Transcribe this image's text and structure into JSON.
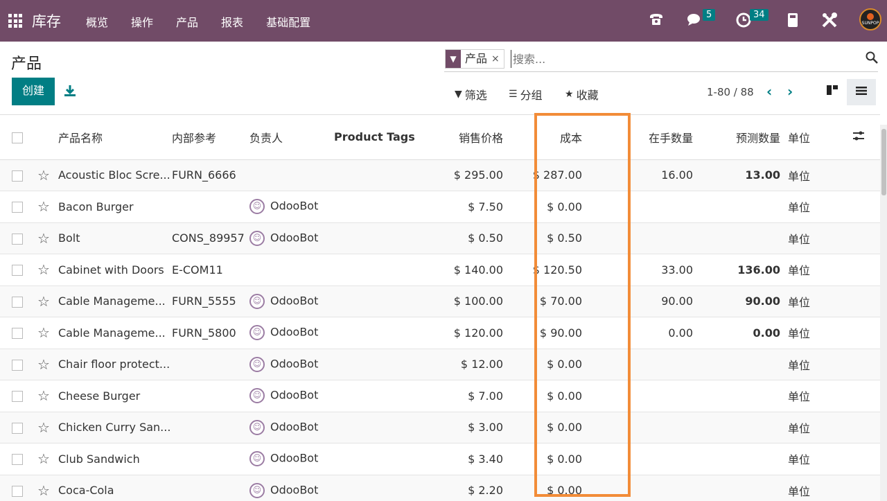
{
  "topbar": {
    "app_title": "库存",
    "menu": [
      "概览",
      "操作",
      "产品",
      "报表",
      "基础配置"
    ],
    "messages_count": "5",
    "activities_count": "34",
    "avatar_text": "SUNPOP"
  },
  "page": {
    "title": "产品"
  },
  "buttons": {
    "create": "创建"
  },
  "search": {
    "facet_label": "产品",
    "placeholder": "搜索..."
  },
  "controls": {
    "filter": "筛选",
    "group": "分组",
    "favorites": "收藏"
  },
  "pager": {
    "text": "1-80 / 88"
  },
  "table": {
    "headers": {
      "name": "产品名称",
      "ref": "内部参考",
      "responsible": "负责人",
      "tags": "Product Tags",
      "price": "销售价格",
      "cost": "成本",
      "onhand": "在手数量",
      "forecast": "预测数量",
      "uom": "单位"
    },
    "rows": [
      {
        "name": "Acoustic Bloc Scre...",
        "ref": "FURN_6666",
        "responsible": "",
        "price": "$ 295.00",
        "cost": "$ 287.00",
        "onhand": "16.00",
        "forecast": "13.00",
        "uom": "单位"
      },
      {
        "name": "Bacon Burger",
        "ref": "",
        "responsible": "OdooBot",
        "price": "$ 7.50",
        "cost": "$ 0.00",
        "onhand": "",
        "forecast": "",
        "uom": "单位"
      },
      {
        "name": "Bolt",
        "ref": "CONS_89957",
        "responsible": "OdooBot",
        "price": "$ 0.50",
        "cost": "$ 0.50",
        "onhand": "",
        "forecast": "",
        "uom": "单位"
      },
      {
        "name": "Cabinet with Doors",
        "ref": "E-COM11",
        "responsible": "",
        "price": "$ 140.00",
        "cost": "$ 120.50",
        "onhand": "33.00",
        "forecast": "136.00",
        "uom": "单位"
      },
      {
        "name": "Cable Manageme...",
        "ref": "FURN_5555",
        "responsible": "OdooBot",
        "price": "$ 100.00",
        "cost": "$ 70.00",
        "onhand": "90.00",
        "forecast": "90.00",
        "uom": "单位"
      },
      {
        "name": "Cable Manageme...",
        "ref": "FURN_5800",
        "responsible": "OdooBot",
        "price": "$ 120.00",
        "cost": "$ 90.00",
        "onhand": "0.00",
        "forecast": "0.00",
        "uom": "单位"
      },
      {
        "name": "Chair floor protect...",
        "ref": "",
        "responsible": "OdooBot",
        "price": "$ 12.00",
        "cost": "$ 0.00",
        "onhand": "",
        "forecast": "",
        "uom": "单位"
      },
      {
        "name": "Cheese Burger",
        "ref": "",
        "responsible": "OdooBot",
        "price": "$ 7.00",
        "cost": "$ 0.00",
        "onhand": "",
        "forecast": "",
        "uom": "单位"
      },
      {
        "name": "Chicken Curry San...",
        "ref": "",
        "responsible": "OdooBot",
        "price": "$ 3.00",
        "cost": "$ 0.00",
        "onhand": "",
        "forecast": "",
        "uom": "单位"
      },
      {
        "name": "Club Sandwich",
        "ref": "",
        "responsible": "OdooBot",
        "price": "$ 3.40",
        "cost": "$ 0.00",
        "onhand": "",
        "forecast": "",
        "uom": "单位"
      },
      {
        "name": "Coca-Cola",
        "ref": "",
        "responsible": "OdooBot",
        "price": "$ 2.20",
        "cost": "$ 0.00",
        "onhand": "",
        "forecast": "",
        "uom": "单位"
      }
    ]
  },
  "colors": {
    "brand": "#714b67",
    "accent": "#017e84",
    "highlight": "#f28c38"
  }
}
